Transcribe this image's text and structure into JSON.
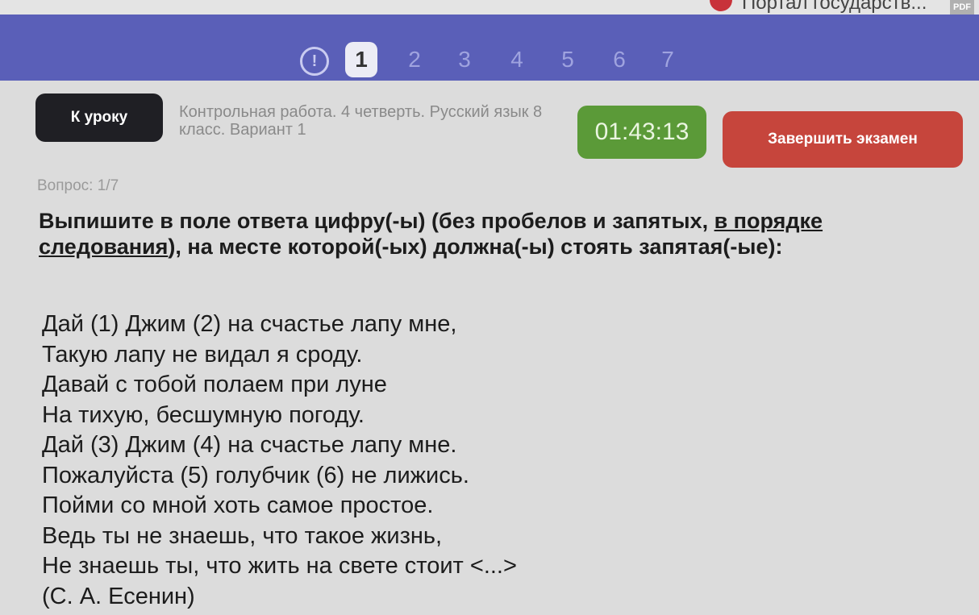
{
  "browser": {
    "tab_title": "Портал государств...",
    "pdf_label": "PDF"
  },
  "question_nav": {
    "alert_icon": "!",
    "numbers": [
      "1",
      "2",
      "3",
      "4",
      "5",
      "6",
      "7"
    ],
    "active": "1"
  },
  "header": {
    "back_button": "К уроку",
    "exam_title": "Контрольная работа. 4 четверть. Русский язык 8 класс. Вариант 1",
    "timer": "01:43:13",
    "finish_button": "Завершить экзамен"
  },
  "question": {
    "counter": "Вопрос: 1/7",
    "instruction_part1": "Выпишите в поле ответа цифру(-ы) (без пробелов и запятых, ",
    "instruction_underlined": "в порядке следования",
    "instruction_part2": "), на месте которой(-ых) должна(-ы) стоять запятая(-ые):",
    "poem_lines": [
      "Дай (1) Джим (2) на счастье лапу мне,",
      "Такую лапу не видал я сроду.",
      "Давай с тобой полаем при луне",
      "На тихую, бесшумную погоду.",
      "Дай (3) Джим (4) на счастье лапу мне.",
      "Пожалуйста (5) голубчик (6) не лижись.",
      "Пойми со мной хоть самое простое.",
      "Ведь ты не знаешь, что такое жизнь,",
      "Не знаешь ты, что жить на свете стоит <...>",
      "(С. А. Есенин)"
    ]
  },
  "colors": {
    "nav_bg": "#5a5fb8",
    "timer_bg": "#5b9a38",
    "finish_bg": "#c6453c",
    "back_bg": "#1f1f24"
  }
}
